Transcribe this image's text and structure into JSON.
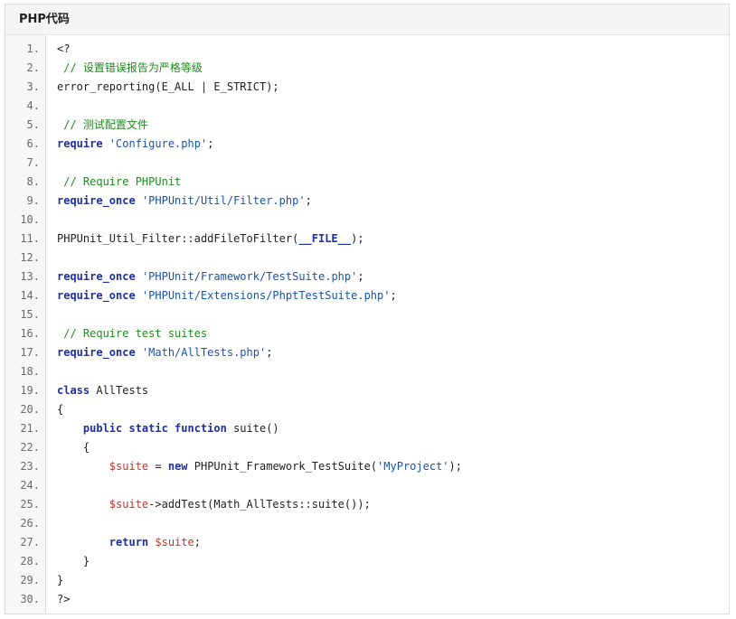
{
  "header": {
    "title": "PHP代码"
  },
  "lines": [
    {
      "n": "1.",
      "t": [
        {
          "s": "<?",
          "k": "p"
        }
      ]
    },
    {
      "n": "2.",
      "t": [
        {
          "s": " // 设置错误报告为严格等级",
          "k": "cmt"
        }
      ]
    },
    {
      "n": "3.",
      "t": [
        {
          "s": "error_reporting(E_ALL | E_STRICT);",
          "k": "p"
        }
      ]
    },
    {
      "n": "4.",
      "t": []
    },
    {
      "n": "5.",
      "t": [
        {
          "s": " // 测试配置文件",
          "k": "cmt"
        }
      ]
    },
    {
      "n": "6.",
      "t": [
        {
          "s": "require",
          "k": "kw"
        },
        {
          "s": " ",
          "k": "p"
        },
        {
          "s": "'Configure.php'",
          "k": "str"
        },
        {
          "s": ";",
          "k": "p"
        }
      ]
    },
    {
      "n": "7.",
      "t": []
    },
    {
      "n": "8.",
      "t": [
        {
          "s": " // Require PHPUnit",
          "k": "cmt"
        }
      ]
    },
    {
      "n": "9.",
      "t": [
        {
          "s": "require_once",
          "k": "kw"
        },
        {
          "s": " ",
          "k": "p"
        },
        {
          "s": "'PHPUnit/Util/Filter.php'",
          "k": "str"
        },
        {
          "s": ";",
          "k": "p"
        }
      ]
    },
    {
      "n": "10.",
      "t": []
    },
    {
      "n": "11.",
      "t": [
        {
          "s": "PHPUnit_Util_Filter::addFileToFilter(",
          "k": "p"
        },
        {
          "s": "__FILE__",
          "k": "kw"
        },
        {
          "s": ");",
          "k": "p"
        }
      ]
    },
    {
      "n": "12.",
      "t": []
    },
    {
      "n": "13.",
      "t": [
        {
          "s": "require_once",
          "k": "kw"
        },
        {
          "s": " ",
          "k": "p"
        },
        {
          "s": "'PHPUnit/Framework/TestSuite.php'",
          "k": "str"
        },
        {
          "s": ";",
          "k": "p"
        }
      ]
    },
    {
      "n": "14.",
      "t": [
        {
          "s": "require_once",
          "k": "kw"
        },
        {
          "s": " ",
          "k": "p"
        },
        {
          "s": "'PHPUnit/Extensions/PhptTestSuite.php'",
          "k": "str"
        },
        {
          "s": ";",
          "k": "p"
        }
      ]
    },
    {
      "n": "15.",
      "t": []
    },
    {
      "n": "16.",
      "t": [
        {
          "s": " // Require test suites",
          "k": "cmt"
        }
      ]
    },
    {
      "n": "17.",
      "t": [
        {
          "s": "require_once",
          "k": "kw"
        },
        {
          "s": " ",
          "k": "p"
        },
        {
          "s": "'Math/AllTests.php'",
          "k": "str"
        },
        {
          "s": ";",
          "k": "p"
        }
      ]
    },
    {
      "n": "18.",
      "t": []
    },
    {
      "n": "19.",
      "t": [
        {
          "s": "class",
          "k": "kw"
        },
        {
          "s": " AllTests",
          "k": "p"
        }
      ]
    },
    {
      "n": "20.",
      "t": [
        {
          "s": "{",
          "k": "p"
        }
      ]
    },
    {
      "n": "21.",
      "t": [
        {
          "s": "    ",
          "k": "p"
        },
        {
          "s": "public static function",
          "k": "kw"
        },
        {
          "s": " suite()",
          "k": "p"
        }
      ]
    },
    {
      "n": "22.",
      "t": [
        {
          "s": "    {",
          "k": "p"
        }
      ]
    },
    {
      "n": "23.",
      "t": [
        {
          "s": "        ",
          "k": "p"
        },
        {
          "s": "$suite",
          "k": "var"
        },
        {
          "s": " = ",
          "k": "p"
        },
        {
          "s": "new",
          "k": "kw"
        },
        {
          "s": " PHPUnit_Framework_TestSuite(",
          "k": "p"
        },
        {
          "s": "'MyProject'",
          "k": "str"
        },
        {
          "s": ");",
          "k": "p"
        }
      ]
    },
    {
      "n": "24.",
      "t": []
    },
    {
      "n": "25.",
      "t": [
        {
          "s": "        ",
          "k": "p"
        },
        {
          "s": "$suite",
          "k": "var"
        },
        {
          "s": "->addTest(Math_AllTests::suite());",
          "k": "p"
        }
      ]
    },
    {
      "n": "26.",
      "t": []
    },
    {
      "n": "27.",
      "t": [
        {
          "s": "        ",
          "k": "p"
        },
        {
          "s": "return",
          "k": "kw"
        },
        {
          "s": " ",
          "k": "p"
        },
        {
          "s": "$suite",
          "k": "var"
        },
        {
          "s": ";",
          "k": "p"
        }
      ]
    },
    {
      "n": "28.",
      "t": [
        {
          "s": "    }",
          "k": "p"
        }
      ]
    },
    {
      "n": "29.",
      "t": [
        {
          "s": "}",
          "k": "p"
        }
      ]
    },
    {
      "n": "30.",
      "t": [
        {
          "s": "?>",
          "k": "p"
        }
      ]
    }
  ]
}
